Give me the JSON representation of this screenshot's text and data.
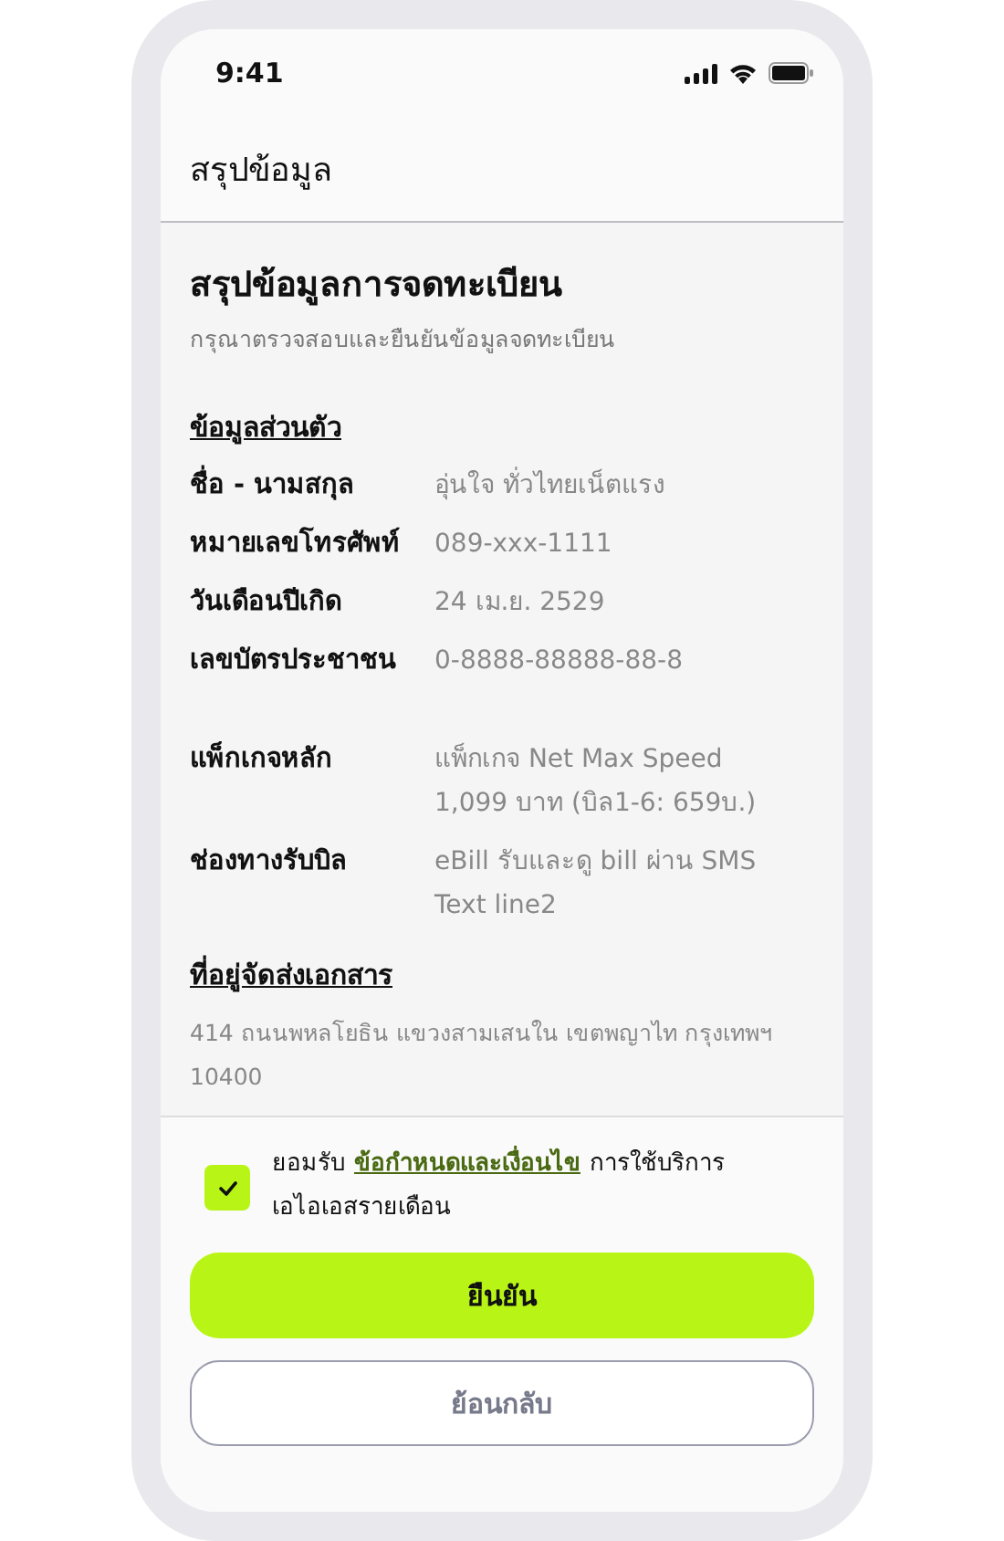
{
  "status_bar": {
    "time": "9:41"
  },
  "header": {
    "title": "สรุปข้อมูล"
  },
  "summary": {
    "title": "สรุปข้อมูลการจดทะเบียน",
    "subtitle": "กรุณาตรวจสอบและยืนยันข้อมูลจดทะเบียน"
  },
  "personal": {
    "heading": "ข้อมูลส่วนตัว",
    "rows": [
      {
        "label": "ชื่อ - นามสกุล",
        "value": [
          "อุ่นใจ ทั่วไทยเน็ตแรง"
        ]
      },
      {
        "label": "หมายเลขโทรศัพท์",
        "value": [
          "089-xxx-1111"
        ]
      },
      {
        "label": "วันเดือนปีเกิด",
        "value": [
          "24 เม.ย. 2529"
        ]
      },
      {
        "label": "เลขบัตรประชาชน",
        "value": [
          "0-8888-88888-88-8"
        ]
      }
    ]
  },
  "service": {
    "rows": [
      {
        "label": "แพ็กเกจหลัก",
        "value": [
          "แพ็กเกจ Net Max Speed",
          "1,099 บาท (บิล1-6: 659บ.)"
        ]
      },
      {
        "label": "ช่องทางรับบิล",
        "value": [
          "eBill รับและดู bill ผ่าน SMS",
          "Text line2"
        ]
      }
    ]
  },
  "address": {
    "heading": "ที่อยู่จัดส่งเอกสาร",
    "lines": [
      "414 ถนนพหลโยธิน แขวงสามเสนใน เขตพญาไท กรุงเทพฯ",
      "10400"
    ]
  },
  "consent": {
    "checked": true,
    "before": "ยอมรับ",
    "link": "ข้อกำหนดและเงื่อนไข",
    "after": "การใช้บริการ",
    "line2": "เอไอเอสรายเดือน"
  },
  "buttons": [
    {
      "kind": "primary",
      "label": "ยืนยัน"
    },
    {
      "kind": "secondary",
      "label": "ย้อนกลับ"
    }
  ]
}
